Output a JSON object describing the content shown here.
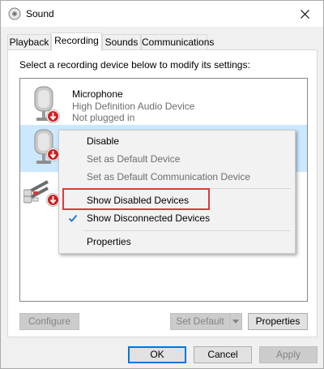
{
  "window": {
    "title": "Sound",
    "close_icon": "close-icon",
    "title_icon": "speaker-icon"
  },
  "tabs": [
    {
      "label": "Playback",
      "active": false
    },
    {
      "label": "Recording",
      "active": true
    },
    {
      "label": "Sounds",
      "active": false
    },
    {
      "label": "Communications",
      "active": false
    }
  ],
  "recording": {
    "instruction": "Select a recording device below to modify its settings:",
    "devices": [
      {
        "name": "Microphone",
        "line2": "High Definition Audio Device",
        "line3": "Not plugged in",
        "icon": "microphone-icon",
        "status_icon": "unplugged-arrow-icon",
        "selected": false
      },
      {
        "name": "",
        "line2": "",
        "line3": "",
        "icon": "microphone-icon",
        "status_icon": "unplugged-arrow-icon",
        "selected": true
      },
      {
        "name": "",
        "line2": "",
        "line3": "",
        "icon": "line-in-icon",
        "status_icon": "unplugged-arrow-icon",
        "selected": false
      }
    ]
  },
  "context_menu": {
    "items": [
      {
        "label": "Disable",
        "enabled": true,
        "checked": false
      },
      {
        "label": "Set as Default Device",
        "enabled": false,
        "checked": false
      },
      {
        "label": "Set as Default Communication Device",
        "enabled": false,
        "checked": false
      },
      {
        "label": "Show Disabled Devices",
        "enabled": true,
        "checked": false,
        "highlighted": true
      },
      {
        "label": "Show Disconnected Devices",
        "enabled": true,
        "checked": true
      },
      {
        "label": "Properties",
        "enabled": true,
        "checked": false
      }
    ],
    "highlight_color": "#e0383e"
  },
  "panel_buttons": {
    "configure": "Configure",
    "set_default": "Set Default",
    "properties": "Properties"
  },
  "dialog_buttons": {
    "ok": "OK",
    "cancel": "Cancel",
    "apply": "Apply"
  },
  "colors": {
    "selection": "#cce8ff",
    "accent": "#0078d7"
  }
}
